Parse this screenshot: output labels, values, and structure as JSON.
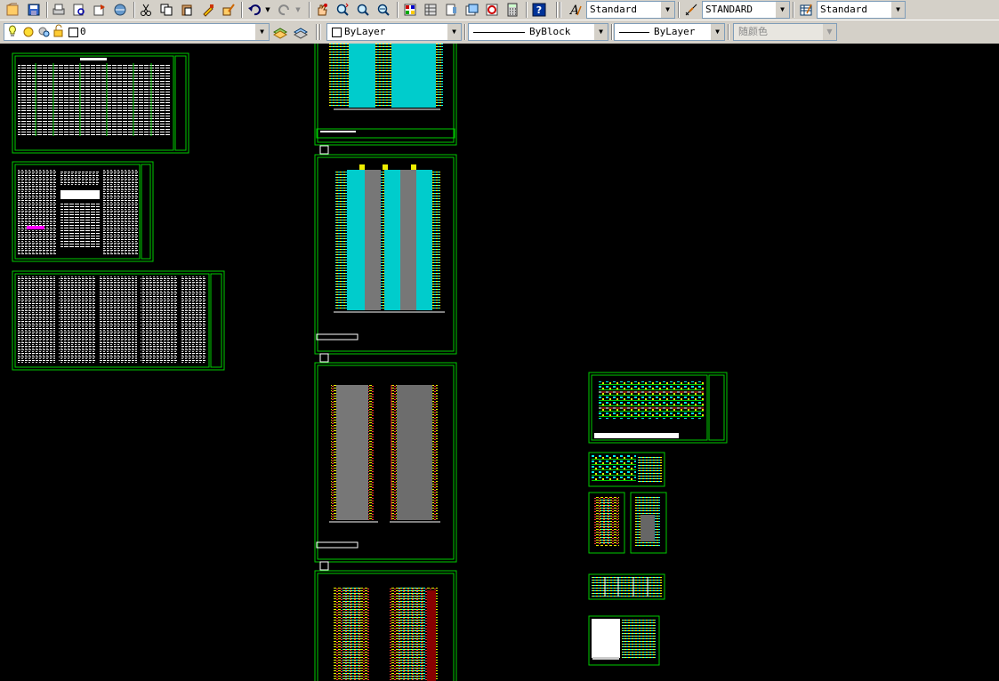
{
  "toolbar_standard": {
    "text_style_value": "Standard",
    "dim_style_value": "STANDARD",
    "table_style_value": "Standard",
    "icons": [
      "new-icon",
      "save-icon",
      "print-icon",
      "preview-icon",
      "publish-icon",
      "plot-icon",
      "cut-icon",
      "copy-icon",
      "paste-icon",
      "match-prop-icon",
      "block-editor-icon",
      "undo-icon",
      "redo-icon",
      "pan-icon",
      "zoom-realtime-icon",
      "zoom-window-icon",
      "zoom-previous-icon",
      "properties-icon",
      "design-center-icon",
      "tool-palette-icon",
      "sheet-set-icon",
      "markup-icon",
      "calculator-icon",
      "help-icon",
      "text-style-icon",
      "dim-style-icon",
      "table-style-icon"
    ]
  },
  "toolbar_layers": {
    "layer_value": "0",
    "color_value": "ByLayer",
    "linetype_value": "ByBlock",
    "lineweight_value": "ByLayer",
    "plotstyle_value": "随颜色"
  },
  "colors": {
    "toolbar_bg": "#d4d0c8",
    "canvas_bg": "#000000",
    "sheet_border": "#00cc00",
    "cyan": "#00e5e5",
    "yellow": "#e6e600",
    "gray": "#808080"
  }
}
